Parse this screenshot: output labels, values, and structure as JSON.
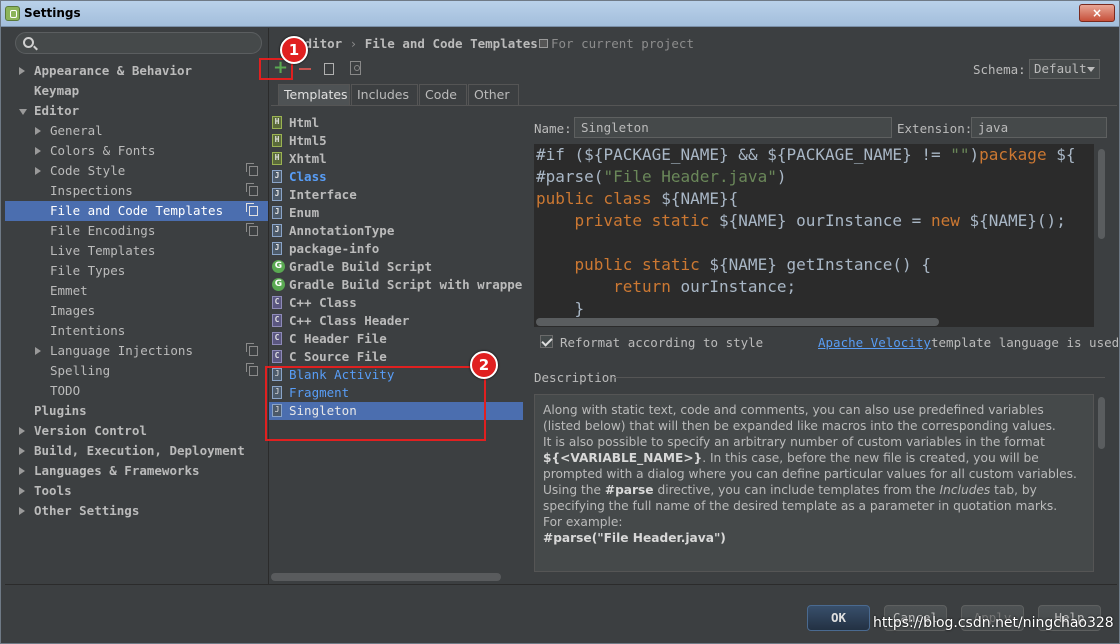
{
  "window": {
    "title": "Settings",
    "close": "×"
  },
  "search": {
    "placeholder": ""
  },
  "tree": [
    {
      "label": "Appearance & Behavior",
      "bold": true,
      "level": 0,
      "arrow": "closed"
    },
    {
      "label": "Keymap",
      "bold": true,
      "level": 0,
      "arrow": "none"
    },
    {
      "label": "Editor",
      "bold": true,
      "level": 0,
      "arrow": "open"
    },
    {
      "label": "General",
      "level": 1,
      "arrow": "closed"
    },
    {
      "label": "Colors & Fonts",
      "level": 1,
      "arrow": "closed"
    },
    {
      "label": "Code Style",
      "level": 1,
      "arrow": "closed",
      "copy": true
    },
    {
      "label": "Inspections",
      "level": 1,
      "arrow": "none",
      "copy": true
    },
    {
      "label": "File and Code Templates",
      "level": 1,
      "arrow": "none",
      "copy": true,
      "selected": true
    },
    {
      "label": "File Encodings",
      "level": 1,
      "arrow": "none",
      "copy": true
    },
    {
      "label": "Live Templates",
      "level": 1,
      "arrow": "none"
    },
    {
      "label": "File Types",
      "level": 1,
      "arrow": "none"
    },
    {
      "label": "Emmet",
      "level": 1,
      "arrow": "none"
    },
    {
      "label": "Images",
      "level": 1,
      "arrow": "none"
    },
    {
      "label": "Intentions",
      "level": 1,
      "arrow": "none"
    },
    {
      "label": "Language Injections",
      "level": 1,
      "arrow": "closed",
      "copy": true
    },
    {
      "label": "Spelling",
      "level": 1,
      "arrow": "none",
      "copy": true
    },
    {
      "label": "TODO",
      "level": 1,
      "arrow": "none"
    },
    {
      "label": "Plugins",
      "bold": true,
      "level": 0,
      "arrow": "none"
    },
    {
      "label": "Version Control",
      "bold": true,
      "level": 0,
      "arrow": "closed"
    },
    {
      "label": "Build, Execution, Deployment",
      "bold": true,
      "level": 0,
      "arrow": "closed"
    },
    {
      "label": "Languages & Frameworks",
      "bold": true,
      "level": 0,
      "arrow": "closed"
    },
    {
      "label": "Tools",
      "bold": true,
      "level": 0,
      "arrow": "closed"
    },
    {
      "label": "Other Settings",
      "bold": true,
      "level": 0,
      "arrow": "closed"
    }
  ],
  "breadcrumb": {
    "part1": "Editor",
    "sep": " › ",
    "part2": "File and Code Templates",
    "note": "For current project"
  },
  "toolbar": {
    "add": "+"
  },
  "schema": {
    "label": "Schema:",
    "value": "Default"
  },
  "tabs": [
    "Templates",
    "Includes",
    "Code",
    "Other"
  ],
  "templates": [
    {
      "label": "Html",
      "icon": "html",
      "style": "b"
    },
    {
      "label": "Html5",
      "icon": "html",
      "style": "b"
    },
    {
      "label": "Xhtml",
      "icon": "html",
      "style": "b"
    },
    {
      "label": "Class",
      "icon": "java",
      "style": "blue"
    },
    {
      "label": "Interface",
      "icon": "java",
      "style": "b"
    },
    {
      "label": "Enum",
      "icon": "java",
      "style": "b"
    },
    {
      "label": "AnnotationType",
      "icon": "java",
      "style": "b"
    },
    {
      "label": "package-info",
      "icon": "java",
      "style": "b"
    },
    {
      "label": "Gradle Build Script",
      "icon": "gradle",
      "style": "b"
    },
    {
      "label": "Gradle Build Script with wrapper",
      "icon": "gradle",
      "style": "b"
    },
    {
      "label": "C++ Class",
      "icon": "cpp",
      "style": "b"
    },
    {
      "label": "C++ Class Header",
      "icon": "cpp",
      "style": "b"
    },
    {
      "label": "C Header File",
      "icon": "cpp",
      "style": "b"
    },
    {
      "label": "C Source File",
      "icon": "cpp",
      "style": "b"
    },
    {
      "label": "Blank Activity",
      "icon": "java",
      "style": "blue nb"
    },
    {
      "label": "Fragment",
      "icon": "java",
      "style": "blue nb"
    },
    {
      "label": "Singleton",
      "icon": "java",
      "style": "sel"
    }
  ],
  "name_field": {
    "label": "Name:",
    "value": "Singleton"
  },
  "ext_field": {
    "label": "Extension:",
    "value": "java"
  },
  "code_lines": [
    [
      [
        "#if (",
        "n"
      ],
      [
        "${PACKAGE_NAME}",
        "n"
      ],
      [
        " && ",
        "n"
      ],
      [
        "${PACKAGE_NAME}",
        "n"
      ],
      [
        " != ",
        "n"
      ],
      [
        "\"\"",
        "s"
      ],
      [
        ")",
        "n"
      ],
      [
        "package",
        "k"
      ],
      [
        " ${",
        "n"
      ]
    ],
    [
      [
        "#parse(",
        "n"
      ],
      [
        "\"File Header.java\"",
        "s"
      ],
      [
        ")",
        "n"
      ]
    ],
    [
      [
        "public class",
        "k"
      ],
      [
        " ${NAME}{",
        "n"
      ]
    ],
    [
      [
        "    ",
        "n"
      ],
      [
        "private static",
        "k"
      ],
      [
        " ${NAME} ourInstance = ",
        "n"
      ],
      [
        "new",
        "k"
      ],
      [
        " ${NAME}();",
        "n"
      ]
    ],
    [
      [
        "",
        "n"
      ]
    ],
    [
      [
        "    ",
        "n"
      ],
      [
        "public static",
        "k"
      ],
      [
        " ${NAME} getInstance() {",
        "n"
      ]
    ],
    [
      [
        "        ",
        "n"
      ],
      [
        "return",
        "k"
      ],
      [
        " ourInstance;",
        "n"
      ]
    ],
    [
      [
        "    }",
        "n"
      ]
    ]
  ],
  "reformat": {
    "checked": true,
    "label": "Reformat according to style"
  },
  "velocity": {
    "link": "Apache Velocity",
    "rest": "template language is used"
  },
  "description": {
    "label": "Description",
    "p1": "Along with static text, code and comments, you can also use predefined variables (listed below) that will then be expanded like macros into the corresponding values.",
    "p2a": "It is also possible to specify an arbitrary number of custom variables in the format ",
    "p2b": "${<VARIABLE_NAME>}",
    "p2c": ". In this case, before the new file is created, you will be prompted with a dialog where you can define particular values for all custom variables.",
    "p3a": "Using the ",
    "p3b": "#parse",
    "p3c": " directive, you can include templates from the ",
    "p3d": "Includes",
    "p3e": " tab, by specifying the full name of the desired template as a parameter in quotation marks.",
    "p4": "For example:",
    "p5": "#parse(\"File Header.java\")"
  },
  "buttons": {
    "ok": "OK",
    "cancel": "Cancel",
    "apply": "Apply",
    "help": "Help"
  },
  "annotations": {
    "badge1": "1",
    "badge2": "2"
  },
  "watermark": "https://blog.csdn.net/ningchao328"
}
